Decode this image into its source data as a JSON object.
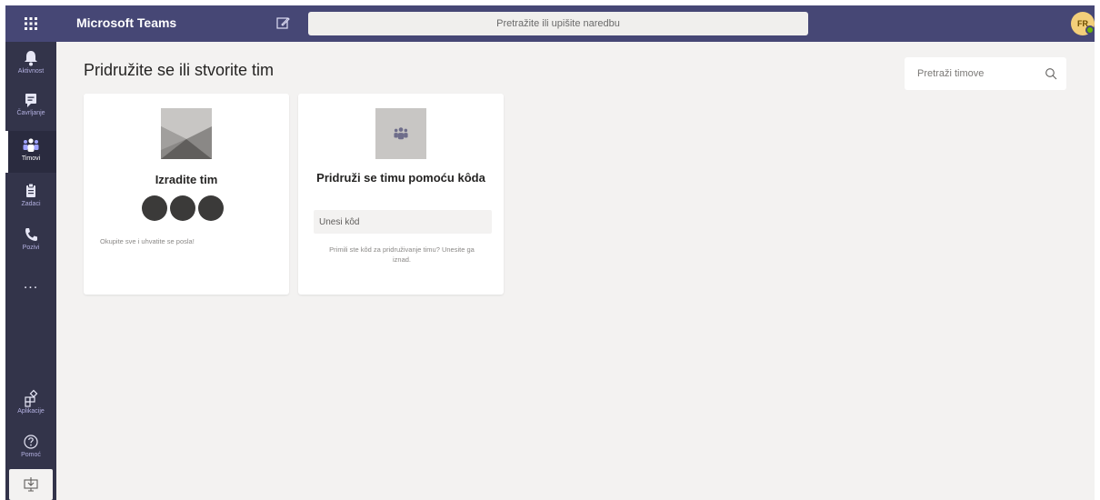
{
  "topbar": {
    "app_title": "Microsoft Teams",
    "command_placeholder": "Pretražite ili upišite naredbu",
    "avatar_initials": "FR",
    "bar_color": "#464775",
    "presence_color": "#6bb700"
  },
  "rail": {
    "items": [
      {
        "label": "Aktivnost",
        "icon": "bell-icon"
      },
      {
        "label": "Čavrljanje",
        "icon": "chat-icon"
      },
      {
        "label": "Timovi",
        "icon": "teams-icon",
        "active": true
      },
      {
        "label": "Zadaci",
        "icon": "assignments-icon"
      },
      {
        "label": "Pozivi",
        "icon": "phone-icon"
      }
    ],
    "more": "...",
    "bottom_items": [
      {
        "label": "Aplikacije",
        "icon": "apps-icon"
      },
      {
        "label": "Pomoć",
        "icon": "help-icon"
      }
    ],
    "download_icon": "download-app-icon"
  },
  "main": {
    "title": "Pridružite se ili stvorite tim",
    "search_placeholder": "Pretraži timove"
  },
  "cards": {
    "create": {
      "title": "Izradite tim",
      "description": "Okupite sve i uhvatite se posla!"
    },
    "join": {
      "title": "Pridruži se timu pomoću kôda",
      "input_placeholder": "Unesi kôd",
      "description": "Primili ste kôd za pridruživanje timu? Unesite ga iznad."
    }
  }
}
